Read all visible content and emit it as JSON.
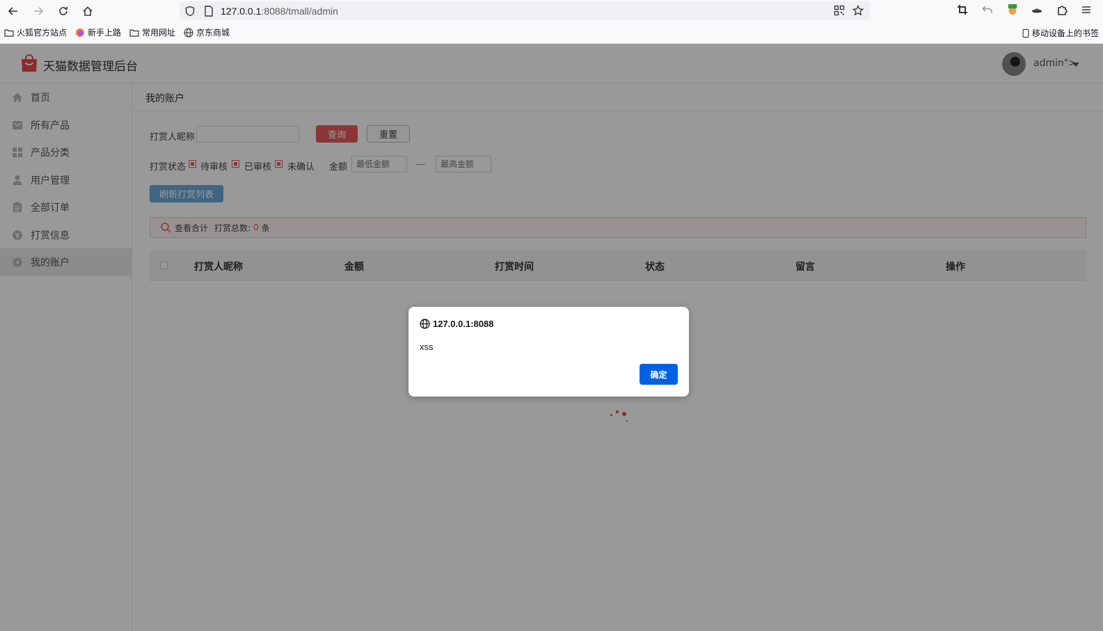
{
  "browser": {
    "url_host": "127.0.0.1",
    "url_rest": ":8088/tmall/admin",
    "bookmarks": [
      "火狐官方站点",
      "新手上路",
      "常用网址",
      "京东商城"
    ],
    "mobile_bookmarks": "移动设备上的书签"
  },
  "header": {
    "title": "天猫数据管理后台",
    "user": "admin\">"
  },
  "sidebar": {
    "items": [
      {
        "label": "首页",
        "icon": "home-icon"
      },
      {
        "label": "所有产品",
        "icon": "product-icon"
      },
      {
        "label": "产品分类",
        "icon": "category-icon"
      },
      {
        "label": "用户管理",
        "icon": "user-icon"
      },
      {
        "label": "全部订单",
        "icon": "order-icon"
      },
      {
        "label": "打赏信息",
        "icon": "reward-icon"
      },
      {
        "label": "我的账户",
        "icon": "gear-icon"
      }
    ],
    "active_index": 6
  },
  "page": {
    "title": "我的账户",
    "filter": {
      "nickname_label": "打赏人昵称",
      "query_button": "查询",
      "reset_button": "重置",
      "status_label": "打赏状态",
      "status_options": [
        "待审核",
        "已审核",
        "未确认"
      ],
      "amount_label": "金额",
      "min_placeholder": "最低金额",
      "max_placeholder": "最高金额",
      "refresh_button": "刷新打赏列表"
    },
    "summary": {
      "view_total": "查看合计",
      "total_label": "打赏总数:",
      "count": "0",
      "unit": "条"
    },
    "table": {
      "columns": [
        "打赏人昵称",
        "金额",
        "打赏时间",
        "状态",
        "留言",
        "操作"
      ]
    }
  },
  "alert": {
    "origin": "127.0.0.1:8088",
    "message": "xss",
    "ok_button": "确定"
  },
  "colors": {
    "primary_red": "#e85a5a",
    "refresh_blue": "#6aa9db",
    "dialog_button": "#0061e0"
  }
}
